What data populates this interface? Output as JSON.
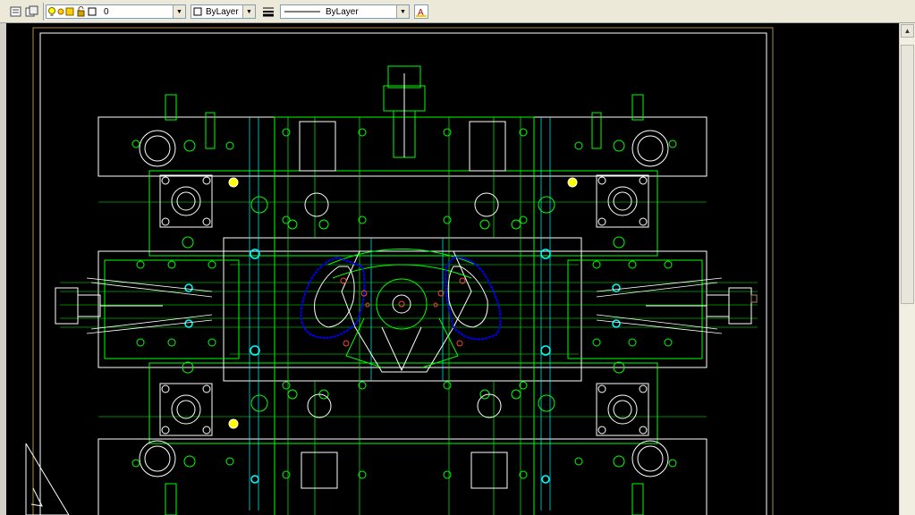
{
  "toolbar": {
    "layer_value": "0",
    "color_value": "ByLayer",
    "linetype_value": "ByLayer",
    "icons": [
      "layer-manager-icon",
      "layer-states-icon",
      "lightbulb-icon",
      "freeze-sun-icon",
      "freeze-viewport-icon",
      "lock-icon",
      "color-square-icon",
      "lineweight-icon",
      "text-style-icon"
    ]
  },
  "colors": {
    "canvas": "#000000",
    "frame": "#b08a50",
    "outline": "#ffffff",
    "part": "#00ff00",
    "detail": "#00d000",
    "hole": "#00ffff",
    "cam": "#0000ff",
    "marker": "#ff4040",
    "yellow": "#ffff00"
  }
}
